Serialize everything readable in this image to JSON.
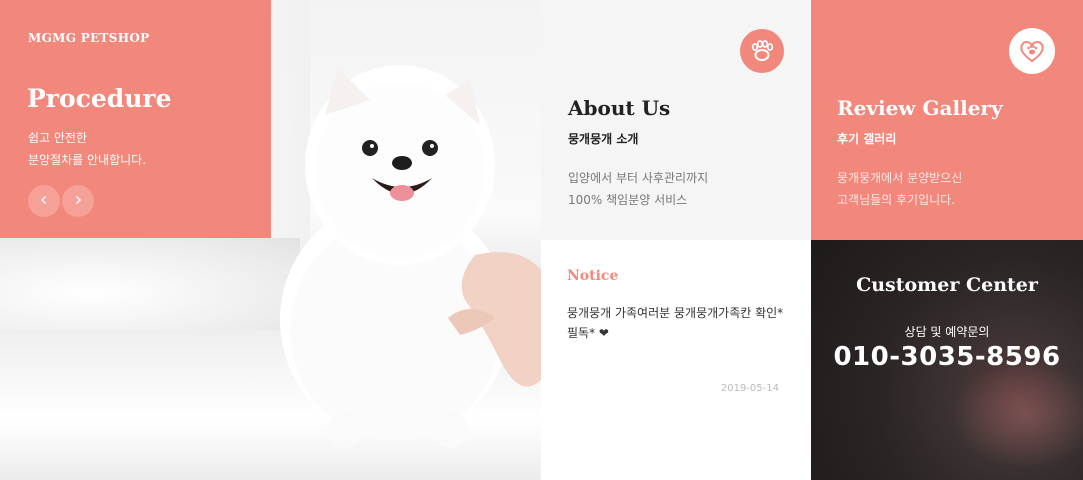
{
  "procedure": {
    "brand": "MGMG PETSHOP",
    "title": "Procedure",
    "desc_line1": "쉽고 안전한",
    "desc_line2": "분양절차를 안내합니다.",
    "prev_icon": "chevron-left-icon",
    "next_icon": "chevron-right-icon",
    "color": "#f2877c"
  },
  "about": {
    "title": "About Us",
    "subtitle": "뭉개뭉개 소개",
    "desc_line1": "입양에서 부터 사후관리까지",
    "desc_line2": "100% 책임분양 서비스",
    "icon": "paw-icon"
  },
  "review": {
    "title": "Review Gallery",
    "subtitle": "후기 갤러리",
    "desc_line1": "뭉개뭉개에서 분양받으신",
    "desc_line2": "고객님들의 후기입니다.",
    "icon": "heart-paw-icon"
  },
  "notice": {
    "title": "Notice",
    "text": "뭉개뭉개 가족여러분 뭉개뭉개가족칸 확인*필독* ❤",
    "date": "2019-05-14"
  },
  "customer": {
    "title": "Customer Center",
    "subtitle": "상담 및 예약문의",
    "phone": "010-3035-8596"
  }
}
